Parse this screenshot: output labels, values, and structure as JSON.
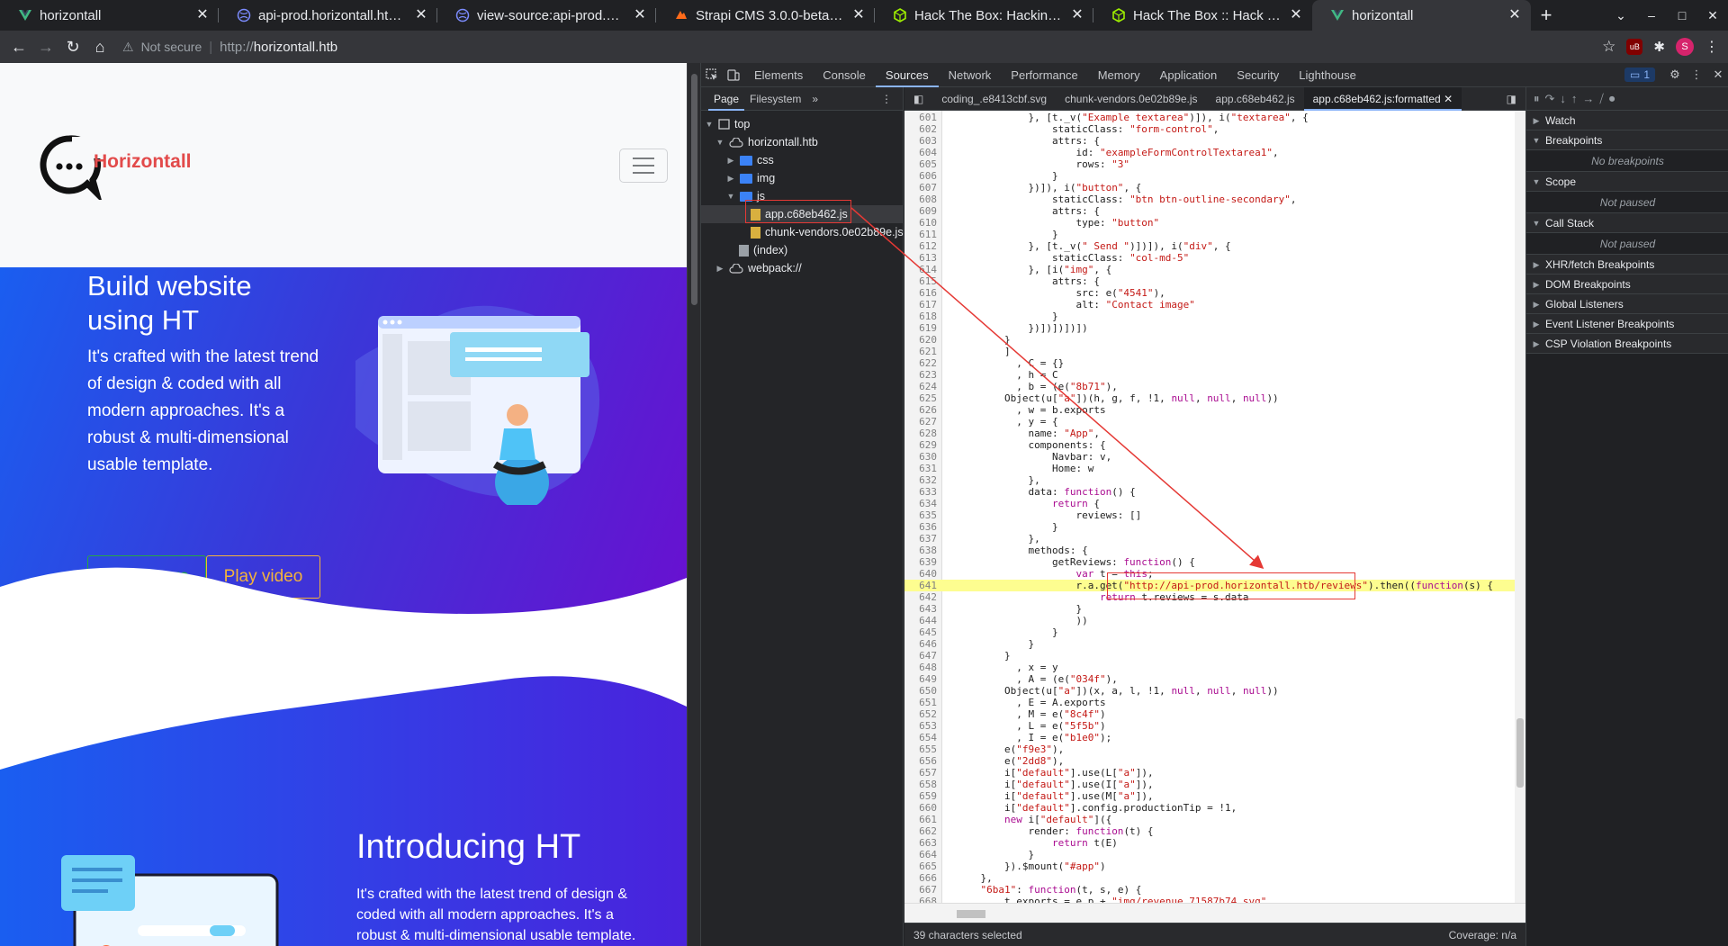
{
  "browser": {
    "tabs": [
      {
        "title": "horizontall",
        "favicon": "vue-icon",
        "active": false
      },
      {
        "title": "api-prod.horizontall.htb/admin",
        "favicon": "globe-icon",
        "active": false
      },
      {
        "title": "view-source:api-prod.horizontall.htb",
        "favicon": "globe-icon",
        "active": false
      },
      {
        "title": "Strapi CMS 3.0.0-beta.17.4",
        "favicon": "exploitdb-icon",
        "active": false
      },
      {
        "title": "Hack The Box: Hacking Training",
        "favicon": "htb-icon",
        "active": false
      },
      {
        "title": "Hack The Box :: Hack The Box",
        "favicon": "htb-icon",
        "active": false
      },
      {
        "title": "horizontall",
        "favicon": "vue-icon",
        "active": true
      }
    ],
    "new_tab": "+",
    "address": {
      "security": "Not secure",
      "scheme": "http://",
      "host": "horizontall.htb"
    },
    "profile_initial": "S",
    "ublock_label": "uB"
  },
  "site": {
    "brand": "Horizontall",
    "hero": {
      "title": "Build website using HT",
      "text": "It's crafted with the latest trend of design & coded with all modern approaches. It's a robust & multi-dimensional usable template.",
      "read_more": "Read more",
      "play_video": "Play video"
    },
    "intro": {
      "title": "Introducing HT",
      "text": "It's crafted with the latest trend of design & coded with all modern approaches. It's a robust & multi-dimensional usable template."
    }
  },
  "devtools": {
    "tabs": [
      "Elements",
      "Console",
      "Sources",
      "Network",
      "Performance",
      "Memory",
      "Application",
      "Security",
      "Lighthouse"
    ],
    "active_tab": "Sources",
    "issues_count": "1",
    "navigator": {
      "subtabs": [
        "Page",
        "Filesystem"
      ],
      "tree": [
        {
          "label": "top",
          "type": "frame",
          "expanded": true
        },
        {
          "label": "horizontall.htb",
          "type": "cloud",
          "expanded": true
        },
        {
          "label": "css",
          "type": "folder",
          "expanded": false
        },
        {
          "label": "img",
          "type": "folder",
          "expanded": false
        },
        {
          "label": "js",
          "type": "folder",
          "expanded": true
        },
        {
          "label": "app.c68eb462.js",
          "type": "file",
          "selected": true
        },
        {
          "label": "chunk-vendors.0e02b89e.js",
          "type": "file"
        },
        {
          "label": "(index)",
          "type": "doc"
        },
        {
          "label": "webpack://",
          "type": "cloud",
          "expanded": false
        }
      ]
    },
    "editor_tabs": [
      {
        "label": "coding_.e8413cbf.svg",
        "active": false
      },
      {
        "label": "chunk-vendors.0e02b89e.js",
        "active": false
      },
      {
        "label": "app.c68eb462.js",
        "active": false
      },
      {
        "label": "app.c68eb462.js:formatted",
        "active": true
      }
    ],
    "code_lines": [
      {
        "n": "601",
        "t": "            }, [t._v(\"Example textarea\")]), i(\"textarea\", {"
      },
      {
        "n": "602",
        "t": "                staticClass: \"form-control\","
      },
      {
        "n": "603",
        "t": "                attrs: {"
      },
      {
        "n": "604",
        "t": "                    id: \"exampleFormControlTextarea1\","
      },
      {
        "n": "605",
        "t": "                    rows: \"3\""
      },
      {
        "n": "606",
        "t": "                }"
      },
      {
        "n": "607",
        "t": "            })]), i(\"button\", {"
      },
      {
        "n": "608",
        "t": "                staticClass: \"btn btn-outline-secondary\","
      },
      {
        "n": "609",
        "t": "                attrs: {"
      },
      {
        "n": "610",
        "t": "                    type: \"button\""
      },
      {
        "n": "611",
        "t": "                }"
      },
      {
        "n": "612",
        "t": "            }, [t._v(\" Send \")])]), i(\"div\", {"
      },
      {
        "n": "613",
        "t": "                staticClass: \"col-md-5\""
      },
      {
        "n": "614",
        "t": "            }, [i(\"img\", {"
      },
      {
        "n": "615",
        "t": "                attrs: {"
      },
      {
        "n": "616",
        "t": "                    src: e(\"4541\"),"
      },
      {
        "n": "617",
        "t": "                    alt: \"Contact image\""
      },
      {
        "n": "618",
        "t": "                }"
      },
      {
        "n": "619",
        "t": "            })])])])])"
      },
      {
        "n": "620",
        "t": "        }"
      },
      {
        "n": "621",
        "t": "        ]"
      },
      {
        "n": "622",
        "t": "          , C = {}"
      },
      {
        "n": "623",
        "t": "          , h = C"
      },
      {
        "n": "624",
        "t": "          , b = (e(\"8b71\"),"
      },
      {
        "n": "625",
        "t": "        Object(u[\"a\"])(h, g, f, !1, null, null, null))"
      },
      {
        "n": "626",
        "t": "          , w = b.exports"
      },
      {
        "n": "627",
        "t": "          , y = {"
      },
      {
        "n": "628",
        "t": "            name: \"App\","
      },
      {
        "n": "629",
        "t": "            components: {"
      },
      {
        "n": "630",
        "t": "                Navbar: v,"
      },
      {
        "n": "631",
        "t": "                Home: w"
      },
      {
        "n": "632",
        "t": "            },"
      },
      {
        "n": "633",
        "t": "            data: function() {"
      },
      {
        "n": "634",
        "t": "                return {"
      },
      {
        "n": "635",
        "t": "                    reviews: []"
      },
      {
        "n": "636",
        "t": "                }"
      },
      {
        "n": "637",
        "t": "            },"
      },
      {
        "n": "638",
        "t": "            methods: {"
      },
      {
        "n": "639",
        "t": "                getReviews: function() {"
      },
      {
        "n": "640",
        "t": "                    var t = this;"
      },
      {
        "n": "641",
        "t": "                    r.a.get(\"http://api-prod.horizontall.htb/reviews\").then((function(s) {",
        "hl": true
      },
      {
        "n": "642",
        "t": "                        return t.reviews = s.data"
      },
      {
        "n": "643",
        "t": "                    }"
      },
      {
        "n": "644",
        "t": "                    ))"
      },
      {
        "n": "645",
        "t": "                }"
      },
      {
        "n": "646",
        "t": "            }"
      },
      {
        "n": "647",
        "t": "        }"
      },
      {
        "n": "648",
        "t": "          , x = y"
      },
      {
        "n": "649",
        "t": "          , A = (e(\"034f\"),"
      },
      {
        "n": "650",
        "t": "        Object(u[\"a\"])(x, a, l, !1, null, null, null))"
      },
      {
        "n": "651",
        "t": "          , E = A.exports"
      },
      {
        "n": "652",
        "t": "          , M = e(\"8c4f\")"
      },
      {
        "n": "653",
        "t": "          , L = e(\"5f5b\")"
      },
      {
        "n": "654",
        "t": "          , I = e(\"b1e0\");"
      },
      {
        "n": "655",
        "t": "        e(\"f9e3\"),"
      },
      {
        "n": "656",
        "t": "        e(\"2dd8\"),"
      },
      {
        "n": "657",
        "t": "        i[\"default\"].use(L[\"a\"]),"
      },
      {
        "n": "658",
        "t": "        i[\"default\"].use(I[\"a\"]),"
      },
      {
        "n": "659",
        "t": "        i[\"default\"].use(M[\"a\"]),"
      },
      {
        "n": "660",
        "t": "        i[\"default\"].config.productionTip = !1,"
      },
      {
        "n": "661",
        "t": "        new i[\"default\"]({"
      },
      {
        "n": "662",
        "t": "            render: function(t) {"
      },
      {
        "n": "663",
        "t": "                return t(E)"
      },
      {
        "n": "664",
        "t": "            }"
      },
      {
        "n": "665",
        "t": "        }).$mount(\"#app\")"
      },
      {
        "n": "666",
        "t": "    },"
      },
      {
        "n": "667",
        "t": "    \"6ba1\": function(t, s, e) {"
      },
      {
        "n": "668",
        "t": "        t.exports = e.p + \"img/revenue.71587b74.svg\""
      },
      {
        "n": "669",
        "t": "    },"
      }
    ],
    "status_left": "39 characters selected",
    "status_right": "Coverage: n/a",
    "debugger": {
      "panes": [
        {
          "title": "Watch",
          "expanded": false
        },
        {
          "title": "Breakpoints",
          "expanded": true,
          "body": "No breakpoints"
        },
        {
          "title": "Scope",
          "expanded": true,
          "body": "Not paused"
        },
        {
          "title": "Call Stack",
          "expanded": true,
          "body": "Not paused"
        },
        {
          "title": "XHR/fetch Breakpoints",
          "expanded": false
        },
        {
          "title": "DOM Breakpoints",
          "expanded": false
        },
        {
          "title": "Global Listeners",
          "expanded": false
        },
        {
          "title": "Event Listener Breakpoints",
          "expanded": false
        },
        {
          "title": "CSP Violation Breakpoints",
          "expanded": false
        }
      ]
    }
  },
  "colors": {
    "annotation": "#e53935",
    "highlight_line": "#fdfd90",
    "hero_start": "#1a5ef0",
    "hero_end": "#6a0fd0"
  }
}
